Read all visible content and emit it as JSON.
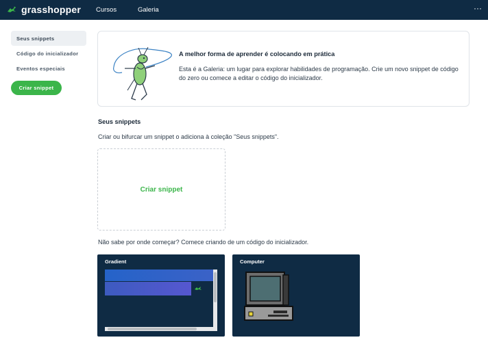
{
  "brand": {
    "name": "grasshopper",
    "icon": "grasshopper-logo-icon"
  },
  "nav": {
    "links": [
      "Cursos",
      "Galeria"
    ],
    "more_icon": "more-dots-icon",
    "more_label": "···"
  },
  "sidebar": {
    "items": [
      {
        "label": "Seus snippets",
        "active": true
      },
      {
        "label": "Código do inicializador",
        "active": false
      },
      {
        "label": "Eventos especiais",
        "active": false
      }
    ],
    "create_button": "Criar snippet"
  },
  "hero": {
    "title": "A melhor forma de aprender é colocando em prática",
    "text": "Esta é a Galeria: um lugar para explorar habilidades de programação. Crie um novo snippet de código do zero ou comece a editar o código do inicializador.",
    "illustration": "grasshopper-with-lasso-illustration"
  },
  "snippets": {
    "title": "Seus snippets",
    "description": "Criar ou bifurcar um snippet o adiciona à coleção \"Seus snippets\".",
    "create_label": "Criar snippet"
  },
  "starters": {
    "description": "Não sabe por onde começar? Comece criando de um código do inicializador.",
    "cards": [
      {
        "name": "Gradient"
      },
      {
        "name": "Computer"
      }
    ]
  },
  "colors": {
    "nav_bg": "#0f2b44",
    "accent_green": "#3bb54a",
    "card_bg": "#0f2b44"
  }
}
